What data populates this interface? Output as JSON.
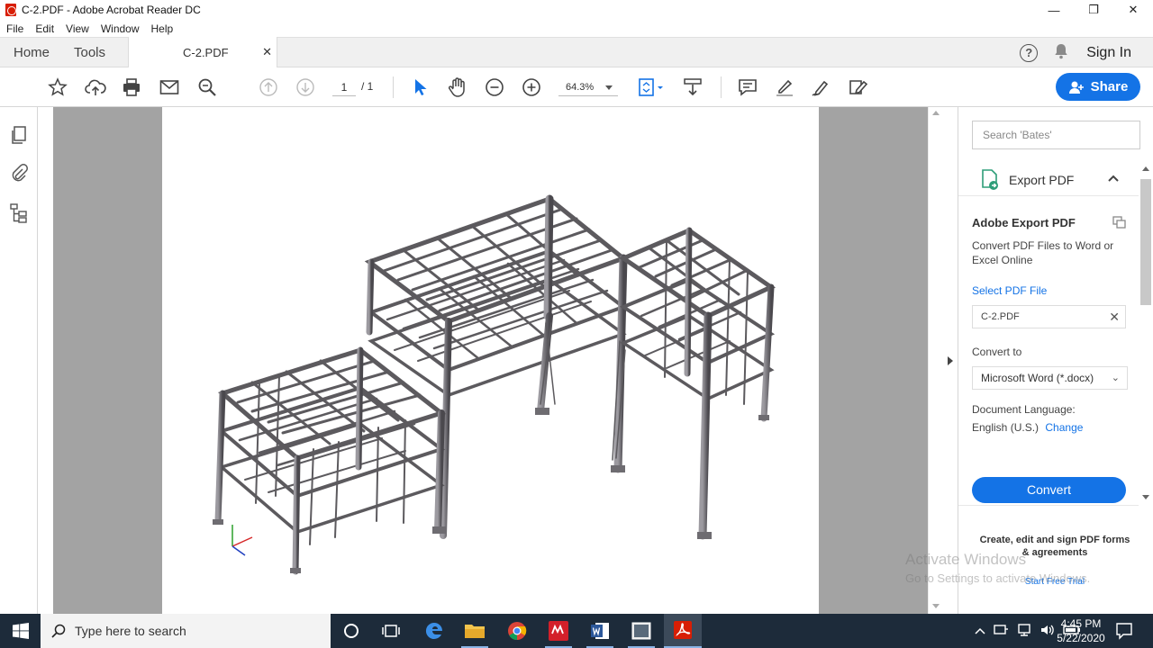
{
  "window": {
    "title": "C-2.PDF - Adobe Acrobat Reader DC",
    "minimize": "—",
    "restore": "❐",
    "close": "✕"
  },
  "menu": [
    "File",
    "Edit",
    "View",
    "Window",
    "Help"
  ],
  "tabs": {
    "home": "Home",
    "tools": "Tools",
    "document": "C-2.PDF",
    "close": "✕"
  },
  "header": {
    "help": "?",
    "sign_in": "Sign In"
  },
  "toolbar": {
    "current_page": "1",
    "page_total": "/ 1",
    "zoom": "64.3%",
    "share_label": "Share"
  },
  "right_panel": {
    "search_placeholder": "Search 'Bates'",
    "export_title": "Export PDF",
    "export_chevron": "⌃",
    "adobe_export_title": "Adobe Export PDF",
    "adobe_export_desc": "Convert PDF Files to Word or Excel Online",
    "select_pdf_label": "Select PDF File",
    "file_name": "C-2.PDF",
    "file_clear": "✕",
    "convert_to_label": "Convert to",
    "convert_to_value": "Microsoft Word (*.docx)",
    "convert_chevron": "⌄",
    "doc_lang_label": "Document Language:",
    "doc_lang_value": "English (U.S.)",
    "doc_lang_change": "Change",
    "convert_button": "Convert",
    "promo_text": "Create, edit and sign PDF forms & agreements",
    "promo_link": "Start Free Trial"
  },
  "watermark": {
    "line1": "Activate Windows",
    "line2": "Go to Settings to activate Windows."
  },
  "taskbar": {
    "search_placeholder": "Type here to search",
    "time": "4:45 PM",
    "date": "5/22/2020"
  },
  "colors": {
    "accent": "#1473e6",
    "taskbar": "#1d2b3a",
    "doc_background": "#a3a3a3",
    "structure": "#5c5a5e"
  }
}
